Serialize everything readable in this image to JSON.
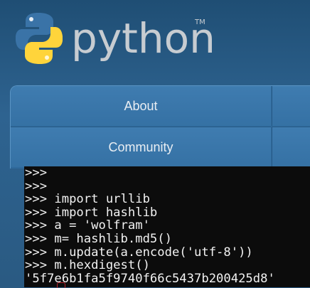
{
  "header": {
    "logo_text": "python",
    "trademark": "TM"
  },
  "nav": {
    "items": [
      {
        "label": "About"
      },
      {
        "label": "Community"
      }
    ]
  },
  "terminal": {
    "lines": [
      ">>>",
      ">>>",
      ">>> import urllib",
      ">>> import hashlib",
      ">>> a = 'wolfram'",
      ">>> m= hashlib.md5()",
      ">>> m.update(a.encode('utf-8'))",
      ">>> m.hexdigest()",
      "'5f7e6b1fa5f9740f66c5437b200425d8'"
    ]
  },
  "colors": {
    "background": "#2b5b84",
    "nav": "#3a76aa",
    "terminal_bg": "#0c0c0c",
    "terminal_text": "#f2f2f2",
    "logo_blue": "#3a73a7",
    "logo_yellow": "#ffd43b"
  }
}
